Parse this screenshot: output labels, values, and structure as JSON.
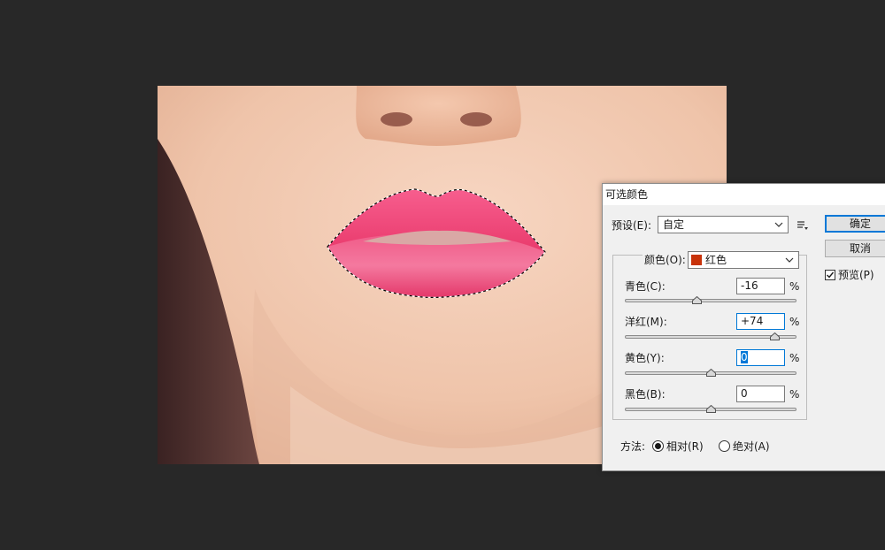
{
  "dialog": {
    "title": "可选颜色",
    "preset_label": "预设(E):",
    "preset_value": "自定",
    "ok_label": "确定",
    "cancel_label": "取消",
    "preview_label": "预览(P)",
    "preview_checked": true,
    "color_label": "颜色(O):",
    "color_value": "红色",
    "color_swatch": "#c8330a",
    "sliders": [
      {
        "label": "青色(C):",
        "value": "-16",
        "percent": -16
      },
      {
        "label": "洋红(M):",
        "value": "+74",
        "percent": 74
      },
      {
        "label": "黄色(Y):",
        "value": "0",
        "percent": 0
      },
      {
        "label": "黑色(B):",
        "value": "0",
        "percent": 0
      }
    ],
    "unit": "%",
    "method_label": "方法:",
    "method_relative": "相对(R)",
    "method_absolute": "绝对(A)",
    "method_selected": "relative"
  },
  "icons": {
    "preset_options": "preset-options-icon",
    "dropdown": "chevron-down-icon"
  },
  "colors": {
    "workspace": "#282828",
    "accent": "#0078d7",
    "lip": "#f0457a"
  }
}
